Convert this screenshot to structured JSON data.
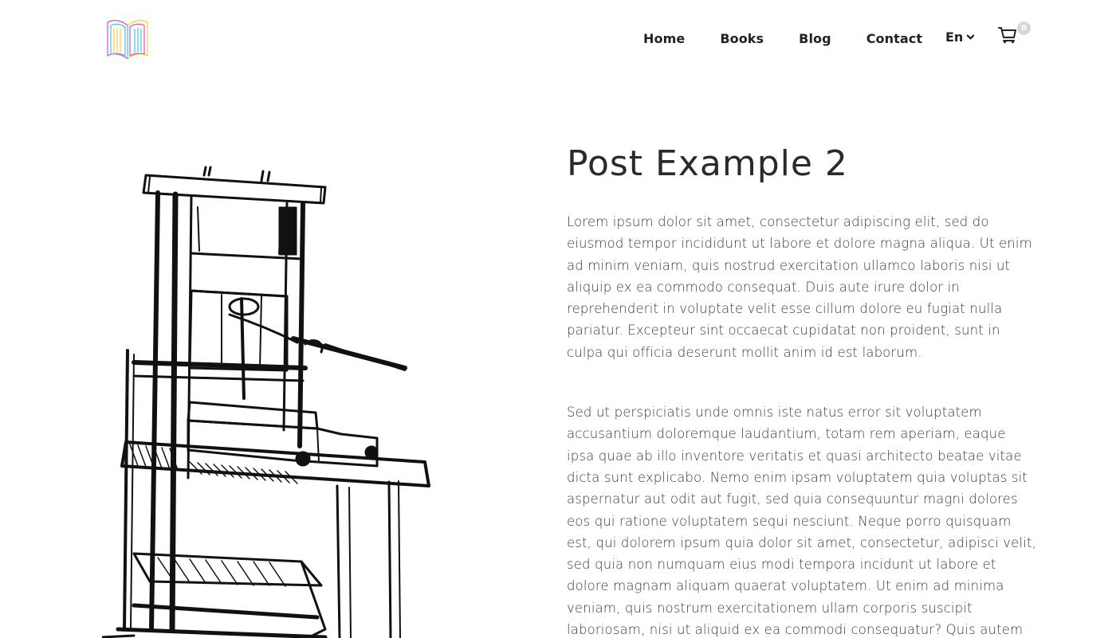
{
  "header": {
    "logo_icon": "open-book-logo",
    "nav": {
      "home": "Home",
      "books": "Books",
      "blog": "Blog",
      "contact": "Contact"
    },
    "language": "En",
    "cart_icon": "shopping-cart-icon",
    "cart_count": "0"
  },
  "post": {
    "title": "Post Example 2",
    "image_icon": "printing-press-illustration",
    "paragraphs": [
      "Lorem ipsum dolor sit amet, consectetur adipiscing elit, sed do eiusmod tempor incididunt ut labore et dolore magna aliqua. Ut enim ad minim veniam, quis nostrud exercitation ullamco laboris nisi ut aliquip ex ea commodo consequat. Duis aute irure dolor in reprehenderit in voluptate velit esse cillum dolore eu fugiat nulla pariatur. Excepteur sint occaecat cupidatat non proident, sunt in culpa qui officia deserunt mollit anim id est laborum.",
      "Sed ut perspiciatis unde omnis iste natus error sit voluptatem accusantium doloremque laudantium, totam rem aperiam, eaque ipsa quae ab illo inventore veritatis et quasi architecto beatae vitae dicta sunt explicabo. Nemo enim ipsam voluptatem quia voluptas sit aspernatur aut odit aut fugit, sed quia consequuntur magni dolores eos qui ratione voluptatem sequi nesciunt. Neque porro quisquam est, qui dolorem ipsum quia dolor sit amet, consectetur, adipisci velit, sed quia non numquam eius modi tempora incidunt ut labore et dolore magnam aliquam quaerat voluptatem. Ut enim ad minima veniam, quis nostrum exercitationem ullam corporis suscipit laboriosam, nisi ut aliquid ex ea commodi consequatur? Quis autem vel eum iure"
    ]
  },
  "colors": {
    "text": "#222222",
    "body_text": "#3a3a3a",
    "badge": "#d7d7d7",
    "logo_pink": "#e94fa8",
    "logo_yellow": "#f2d23a",
    "logo_cyan": "#3fc6e8"
  }
}
